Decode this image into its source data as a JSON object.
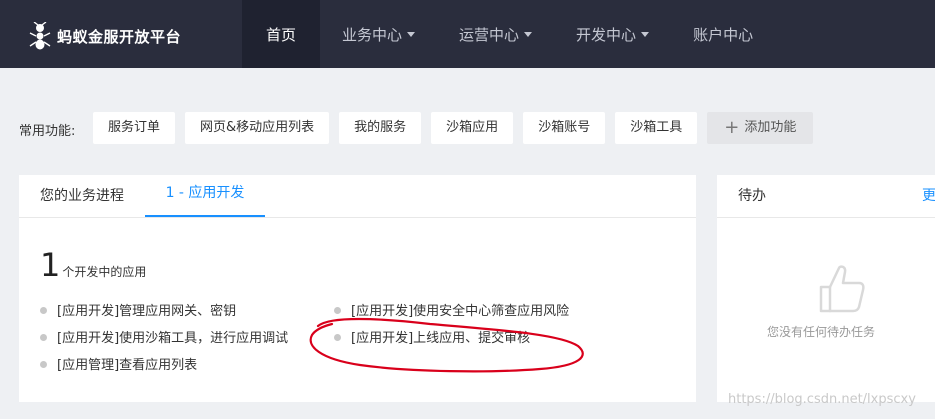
{
  "header": {
    "brand": "蚂蚁金服开放平台",
    "nav": [
      {
        "label": "首页",
        "active": true,
        "dropdown": false
      },
      {
        "label": "业务中心",
        "active": false,
        "dropdown": true
      },
      {
        "label": "运营中心",
        "active": false,
        "dropdown": true
      },
      {
        "label": "开发中心",
        "active": false,
        "dropdown": true
      },
      {
        "label": "账户中心",
        "active": false,
        "dropdown": false
      }
    ],
    "logo_icon": "ant-logo-icon",
    "dropdown_icon": "caret-down-icon"
  },
  "quick": {
    "label": "常用功能:",
    "items": [
      "服务订单",
      "网页&移动应用列表",
      "我的服务",
      "沙箱应用",
      "沙箱账号",
      "沙箱工具"
    ],
    "add_label": "添加功能",
    "add_icon": "plus-icon"
  },
  "progress": {
    "tabs": [
      "您的业务进程",
      "1 - 应用开发"
    ],
    "count": "1",
    "count_label": "个开发中的应用",
    "tasks_left": [
      "[应用开发]管理应用网关、密钥",
      "[应用开发]使用沙箱工具，进行应用调试",
      "[应用管理]查看应用列表"
    ],
    "tasks_right": [
      "[应用开发]使用安全中心筛查应用风险",
      "[应用开发]上线应用、提交审核"
    ]
  },
  "todo": {
    "title": "待办",
    "more": "更",
    "empty": "您没有任何待办任务",
    "empty_icon": "thumbs-up-icon"
  },
  "watermark": "https://blog.csdn.net/lxpscxy",
  "colors": {
    "nav_bg": "#2a2d3d",
    "nav_active_bg": "#1f2230",
    "accent": "#1890ff",
    "annotation": "#d9001b"
  }
}
